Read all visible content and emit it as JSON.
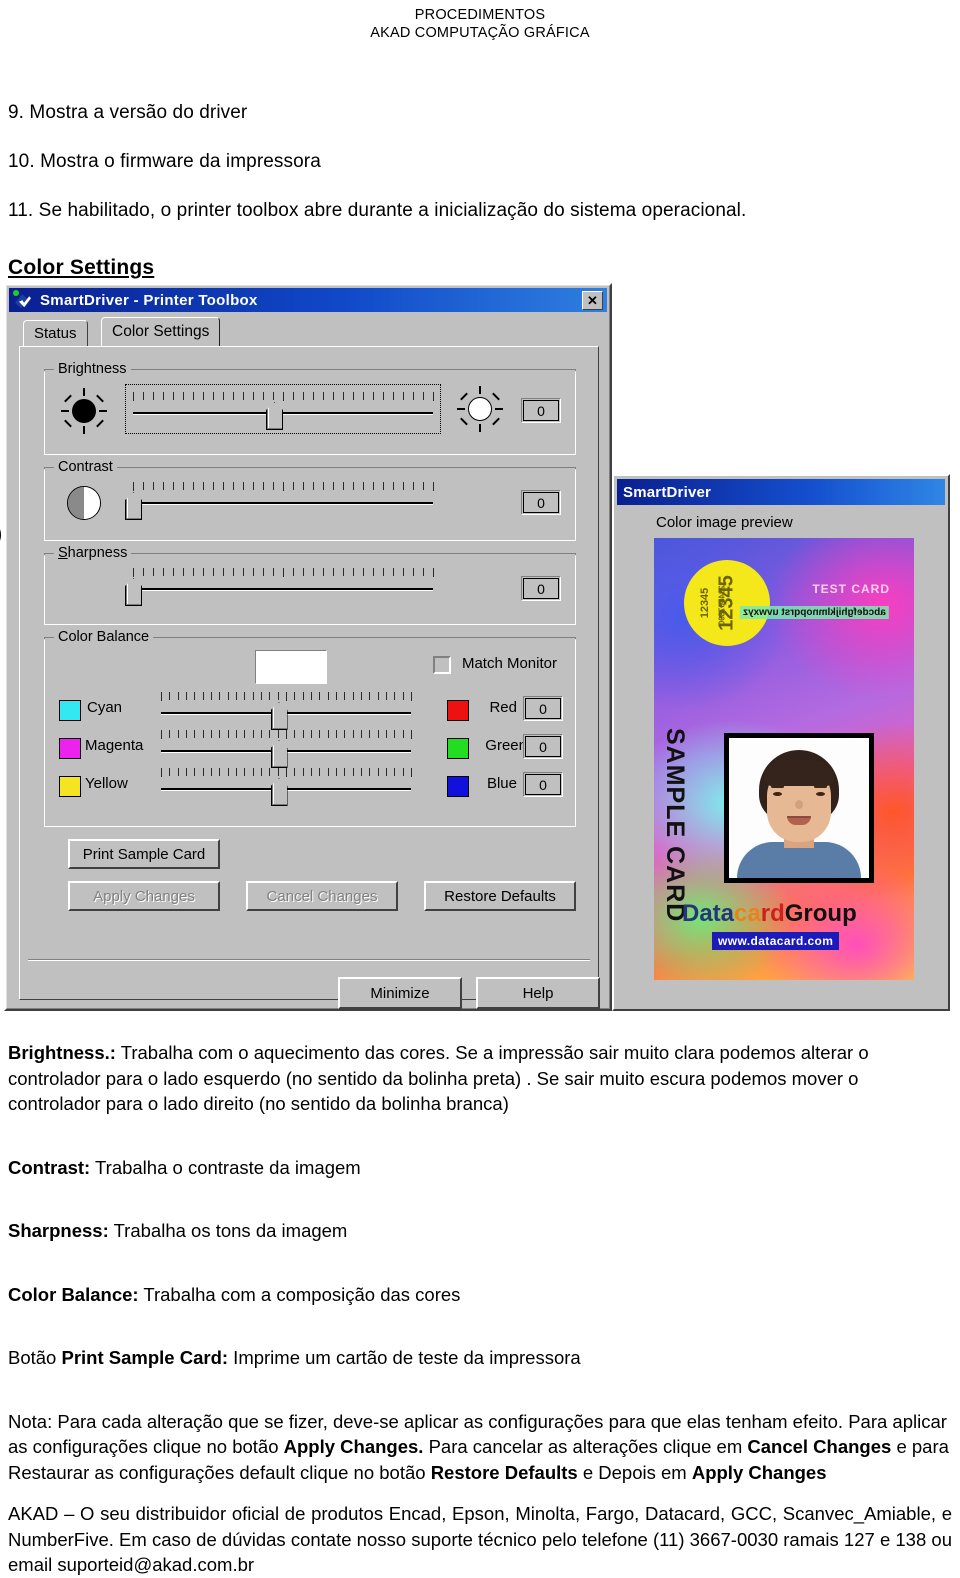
{
  "header": {
    "line1": "PROCEDIMENTOS",
    "line2": "AKAD COMPUTAÇÃO GRÁFICA"
  },
  "numbered_items": [
    "9. Mostra a versão do driver",
    "10. Mostra o firmware da impressora",
    "11. Se habilitado, o printer toolbox abre durante a inicialização do sistema operacional."
  ],
  "section_title": "Color Settings",
  "dialog": {
    "title": "SmartDriver - Printer Toolbox",
    "close_label": "✕",
    "tabs": [
      {
        "label": "Status",
        "active": false
      },
      {
        "label": "Color Settings",
        "active": true
      }
    ],
    "groups": {
      "brightness": {
        "legend": "Brightness",
        "value": "0",
        "thumb_percent": 47
      },
      "contrast": {
        "legend": "Contrast",
        "value": "0",
        "thumb_percent": 0
      },
      "sharpness": {
        "legend": "Sharpness",
        "value": "0",
        "thumb_percent": 0
      },
      "color_balance": {
        "legend": "Color Balance"
      }
    },
    "match_monitor_label": "Match Monitor",
    "color_balance_rows": [
      {
        "left_label": "Cyan",
        "left_color": "#33e8f0",
        "right_label": "Red",
        "right_color": "#ee1111",
        "value": "0",
        "thumb_percent": 47
      },
      {
        "left_label": "Magenta",
        "left_color": "#ee22ee",
        "right_label": "Green",
        "right_color": "#22dd22",
        "value": "0",
        "thumb_percent": 47
      },
      {
        "left_label": "Yellow",
        "left_color": "#f5e422",
        "right_label": "Blue",
        "right_color": "#1111dd",
        "value": "0",
        "thumb_percent": 47
      }
    ],
    "buttons": {
      "print_sample_card": "Print Sample Card",
      "apply_changes": "Apply Changes",
      "cancel_changes": "Cancel Changes",
      "restore_defaults": "Restore Defaults",
      "minimize": "Minimize",
      "help": "Help"
    }
  },
  "preview_window": {
    "title": "SmartDriver",
    "label": "Color image preview",
    "card": {
      "seal_big": "12345",
      "seal_small_left": "12345",
      "seal_small_right": "1234567890",
      "test_card": "TEST CARD",
      "alphabet": "abcdefghijklmnopqrst uvwxyz",
      "sample_card": "SAMPLE CARD",
      "logo": "DatacardGroup",
      "logo_part1": "Data",
      "logo_part2": "ca",
      "logo_part3": "rd",
      "logo_part4": "Group",
      "url": "www.datacard.com"
    }
  },
  "paragraphs": {
    "brightness_label": "Brightness.:",
    "brightness_text": " Trabalha com o aquecimento das cores. Se a impressão sair muito clara podemos alterar o controlador para o lado esquerdo (no sentido da bolinha preta) . Se sair muito escura podemos mover o controlador para o lado direito (no sentido da bolinha branca)",
    "contrast_label": "Contrast:",
    "contrast_text": " Trabalha o contraste da imagem",
    "sharpness_label": "Sharpness:",
    "sharpness_text": " Trabalha os tons da imagem",
    "colorbalance_label": "Color Balance:",
    "colorbalance_text": " Trabalha com a composição das cores",
    "botao_prefix": "Botão ",
    "botao_label": "Print Sample Card:",
    "botao_text": " Imprime um cartão de teste da impressora",
    "nota_p1": "Nota: Para cada alteração que se fizer, deve-se aplicar as configurações para que elas tenham efeito. Para aplicar as configurações clique no botão ",
    "nota_b1": "Apply Changes.",
    "nota_p2": " Para cancelar as alterações clique em ",
    "nota_b2": "Cancel Changes",
    "nota_p3": " e para Restaurar as configurações default clique no botão ",
    "nota_b3": "Restore Defaults",
    "nota_p4": " e Depois em ",
    "nota_b4": "Apply Changes",
    "footer": "AKAD – O seu distribuidor oficial de produtos Encad, Epson, Minolta, Fargo, Datacard, GCC, Scanvec_Amiable, e NumberFive. Em caso de dúvidas contate nosso suporte técnico pelo telefone (11) 3667-0030 ramais 127 e 138 ou email suporteid@akad.com.br"
  }
}
